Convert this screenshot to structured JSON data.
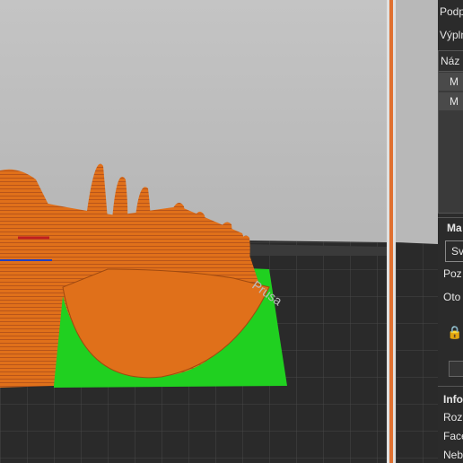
{
  "panel": {
    "line1": "Podp",
    "line2": "Výpln",
    "list_header": "Náz",
    "list_item1": "M",
    "list_item2": "M",
    "section_header": "Ma",
    "dropdown_value": "Sv",
    "line_poz": "Poz",
    "line_oto": "Oto",
    "info_header": "Info",
    "info_line1": "Rozm",
    "info_line2": "Face",
    "info_line3": "Neb"
  },
  "colors": {
    "accent": "#e07030",
    "model": "#e0701a",
    "support": "#20d020"
  }
}
